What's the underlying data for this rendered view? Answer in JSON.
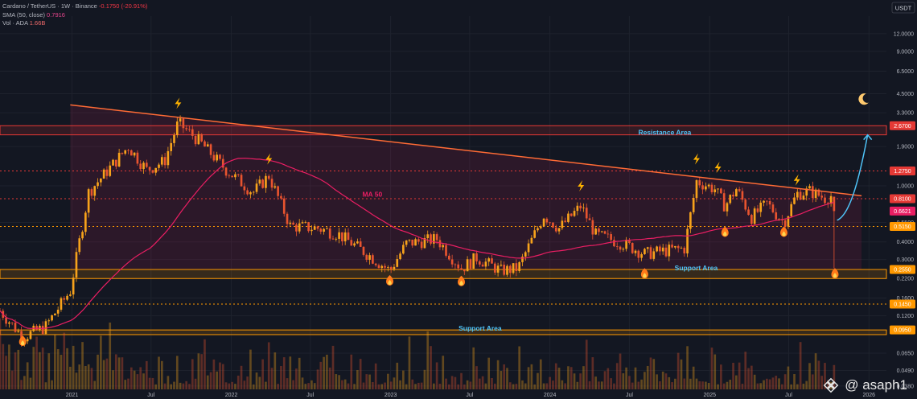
{
  "legend": {
    "symbol": "Cardano / TetherUS · 1W · Binance",
    "change": "-0.1750 (-20.91%)",
    "sma_label": "SMA (50, close)",
    "sma_value": "0.7916",
    "vol_label": "Vol · ADA",
    "vol_value": "1.66B"
  },
  "currency_label": "USDT",
  "watermark": "@ asaph1",
  "chart_data": {
    "type": "candlestick",
    "interval": "1W",
    "y_scale": "log",
    "ylim": [
      0.036,
      16
    ],
    "x_range": [
      "2020-07-20",
      "2026-02-10"
    ],
    "y_ticks": [
      {
        "value": 12.0,
        "label": "12.0000"
      },
      {
        "value": 9.0,
        "label": "9.0000"
      },
      {
        "value": 6.5,
        "label": "6.5000"
      },
      {
        "value": 4.5,
        "label": "4.5000"
      },
      {
        "value": 3.3,
        "label": "3.3000"
      },
      {
        "value": 1.9,
        "label": "1.9000"
      },
      {
        "value": 1.0,
        "label": "1.0000"
      },
      {
        "value": 0.55,
        "label": "0.5500"
      },
      {
        "value": 0.4,
        "label": "0.4000"
      },
      {
        "value": 0.3,
        "label": "0.3000"
      },
      {
        "value": 0.22,
        "label": "0.2200"
      },
      {
        "value": 0.16,
        "label": "0.1600"
      },
      {
        "value": 0.12,
        "label": "0.1200"
      },
      {
        "value": 0.065,
        "label": "0.0650"
      },
      {
        "value": 0.049,
        "label": "0.0490"
      },
      {
        "value": 0.038,
        "label": "0.0380"
      }
    ],
    "price_labels": [
      {
        "value": 2.67,
        "label": "2.6700",
        "color": "#e53935",
        "style": "zone"
      },
      {
        "value": 1.275,
        "label": "1.2750",
        "color": "#e53935",
        "style": "dotted"
      },
      {
        "value": 0.81,
        "label": "0.8100",
        "color": "#e53935",
        "style": "dotted"
      },
      {
        "value": 0.6621,
        "label": "0.6621",
        "color": "#e91e63",
        "style": "none"
      },
      {
        "value": 0.515,
        "label": "0.5150",
        "color": "#ff9800",
        "style": "dotted"
      },
      {
        "value": 0.255,
        "label": "0.2550",
        "color": "#ff9800",
        "style": "zone"
      },
      {
        "value": 0.145,
        "label": "0.1450",
        "color": "#ff9800",
        "style": "dotted"
      },
      {
        "value": 0.095,
        "label": "0.0950",
        "color": "#ff9800",
        "style": "zone"
      }
    ],
    "x_ticks": [
      {
        "date": "2021-01-01",
        "label": "2021"
      },
      {
        "date": "2021-07-01",
        "label": "Jul"
      },
      {
        "date": "2022-01-01",
        "label": "2022"
      },
      {
        "date": "2022-07-01",
        "label": "Jul"
      },
      {
        "date": "2023-01-01",
        "label": "2023"
      },
      {
        "date": "2023-07-01",
        "label": "Jul"
      },
      {
        "date": "2024-01-01",
        "label": "2024"
      },
      {
        "date": "2024-07-01",
        "label": "Jul"
      },
      {
        "date": "2025-01-01",
        "label": "2025"
      },
      {
        "date": "2025-07-01",
        "label": "Jul"
      },
      {
        "date": "2026-01-01",
        "label": "2026"
      }
    ],
    "annotations": [
      {
        "text": "Resistance Area",
        "date": "2024-09-20",
        "value": 2.3,
        "color": "#4fc3f7"
      },
      {
        "text": "Support Area",
        "date": "2024-12-01",
        "value": 0.252,
        "color": "#4fc3f7"
      },
      {
        "text": "Support Area",
        "date": "2023-07-25",
        "value": 0.094,
        "color": "#4fc3f7"
      },
      {
        "text": "MA 50",
        "date": "2022-11-20",
        "value": 0.84,
        "color": "#e91e63"
      }
    ],
    "zones": [
      {
        "from": 2.3,
        "to": 2.67,
        "color": "#e53935"
      },
      {
        "from": 0.22,
        "to": 0.255,
        "color": "#ff9800"
      },
      {
        "from": 0.088,
        "to": 0.095,
        "color": "#ff9800"
      }
    ],
    "trendline": {
      "from": {
        "date": "2020-12-28",
        "value": 3.75
      },
      "to": {
        "date": "2025-12-15",
        "value": 0.85
      },
      "color": "#ff6b35"
    },
    "range_box": {
      "date_from": "2020-12-28",
      "date_to": "2025-12-15",
      "top_value": 3.75,
      "bottom_value": 0.255
    },
    "projection": {
      "points": [
        [
          "2025-10-20",
          0.57
        ],
        [
          "2025-11-17",
          0.62
        ],
        [
          "2025-12-08",
          1.05
        ],
        [
          "2025-12-29",
          2.3
        ]
      ],
      "color": "#4fc3f7"
    },
    "markers": [
      {
        "type": "bolt",
        "date": "2021-09-01",
        "value": 3.85
      },
      {
        "type": "bolt",
        "date": "2022-03-28",
        "value": 1.55
      },
      {
        "type": "bolt",
        "date": "2024-03-12",
        "value": 1.0
      },
      {
        "type": "bolt",
        "date": "2024-12-02",
        "value": 1.55
      },
      {
        "type": "bolt",
        "date": "2025-01-20",
        "value": 1.35
      },
      {
        "type": "bolt",
        "date": "2025-07-20",
        "value": 1.1
      },
      {
        "type": "fire",
        "date": "2020-09-10",
        "value": 0.079
      },
      {
        "type": "fire",
        "date": "2022-12-30",
        "value": 0.212
      },
      {
        "type": "fire",
        "date": "2023-06-12",
        "value": 0.21
      },
      {
        "type": "fire",
        "date": "2024-08-05",
        "value": 0.238
      },
      {
        "type": "fire",
        "date": "2025-02-05",
        "value": 0.47
      },
      {
        "type": "fire",
        "date": "2025-06-20",
        "value": 0.47
      },
      {
        "type": "fire",
        "date": "2025-10-15",
        "value": 0.238
      },
      {
        "type": "moon",
        "date": "2025-12-20",
        "value": 4.1
      }
    ],
    "key_prices": [
      {
        "date": "2020-07-20",
        "value": 0.13
      },
      {
        "date": "2020-09-10",
        "value": 0.085
      },
      {
        "date": "2020-11-01",
        "value": 0.1
      },
      {
        "date": "2020-12-28",
        "value": 0.18
      },
      {
        "date": "2021-02-08",
        "value": 0.9
      },
      {
        "date": "2021-03-15",
        "value": 1.2
      },
      {
        "date": "2021-05-10",
        "value": 1.9
      },
      {
        "date": "2021-06-21",
        "value": 1.3
      },
      {
        "date": "2021-08-01",
        "value": 1.5
      },
      {
        "date": "2021-09-01",
        "value": 2.8
      },
      {
        "date": "2021-10-18",
        "value": 2.1
      },
      {
        "date": "2021-12-20",
        "value": 1.3
      },
      {
        "date": "2022-02-20",
        "value": 0.9
      },
      {
        "date": "2022-03-28",
        "value": 1.18
      },
      {
        "date": "2022-05-16",
        "value": 0.52
      },
      {
        "date": "2022-07-18",
        "value": 0.5
      },
      {
        "date": "2022-09-01",
        "value": 0.46
      },
      {
        "date": "2022-11-14",
        "value": 0.32
      },
      {
        "date": "2022-12-30",
        "value": 0.25
      },
      {
        "date": "2023-02-06",
        "value": 0.39
      },
      {
        "date": "2023-04-17",
        "value": 0.42
      },
      {
        "date": "2023-06-12",
        "value": 0.26
      },
      {
        "date": "2023-07-17",
        "value": 0.31
      },
      {
        "date": "2023-09-11",
        "value": 0.25
      },
      {
        "date": "2023-10-20",
        "value": 0.26
      },
      {
        "date": "2023-12-18",
        "value": 0.62
      },
      {
        "date": "2024-01-22",
        "value": 0.5
      },
      {
        "date": "2024-03-12",
        "value": 0.72
      },
      {
        "date": "2024-04-15",
        "value": 0.45
      },
      {
        "date": "2024-06-17",
        "value": 0.39
      },
      {
        "date": "2024-08-05",
        "value": 0.33
      },
      {
        "date": "2024-10-01",
        "value": 0.35
      },
      {
        "date": "2024-11-04",
        "value": 0.36
      },
      {
        "date": "2024-12-02",
        "value": 1.08
      },
      {
        "date": "2025-01-13",
        "value": 0.95
      },
      {
        "date": "2025-02-05",
        "value": 0.72
      },
      {
        "date": "2025-03-03",
        "value": 0.95
      },
      {
        "date": "2025-04-07",
        "value": 0.6
      },
      {
        "date": "2025-05-12",
        "value": 0.75
      },
      {
        "date": "2025-06-20",
        "value": 0.55
      },
      {
        "date": "2025-07-20",
        "value": 0.88
      },
      {
        "date": "2025-08-18",
        "value": 0.92
      },
      {
        "date": "2025-09-22",
        "value": 0.82
      },
      {
        "date": "2025-10-06",
        "value": 0.85
      }
    ],
    "last_candle": {
      "date": "2025-10-13",
      "open": 0.8366,
      "high": 0.84,
      "low": 0.26,
      "close": 0.6621
    },
    "sma50_last": 0.7916,
    "volume_last": "1.66B"
  }
}
